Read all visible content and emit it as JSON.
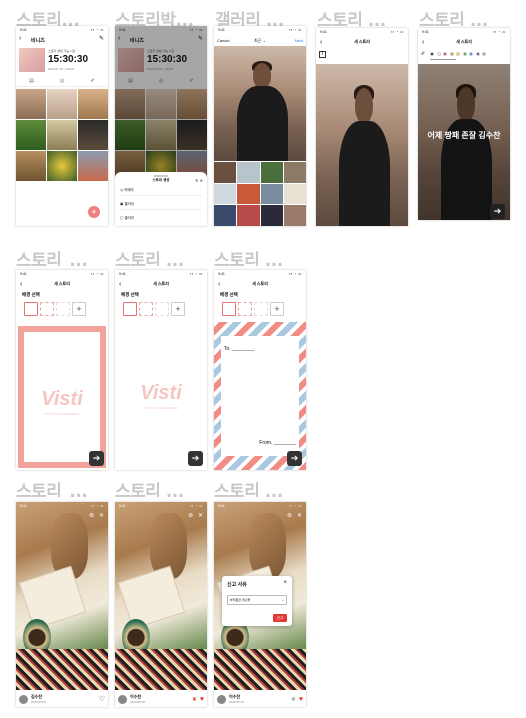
{
  "frame_labels": [
    "스토리...",
    "스토리박...",
    "갤러리 ...",
    "스토리 ...",
    "스토리 ...",
    "스토리_...",
    "스토리 ...",
    "스토리 ...",
    "스토리_...",
    "스토리 ...",
    "스토리 ..."
  ],
  "status_time": "9:41",
  "story_box": {
    "title": "비니즈",
    "sub": "스토리 생성 가능 시간",
    "countdown": "15:30:30",
    "range": "2023.07.15 ~ 08.05",
    "fab": "+"
  },
  "action_sheet": {
    "title": "스토리 생성",
    "items": [
      "카메라",
      "갤러리",
      "갤러리"
    ]
  },
  "gallery": {
    "cancel": "Cancel",
    "title": "최근",
    "next": "Next"
  },
  "story_header": "새 스토리",
  "text_story": {
    "caption": "어제 짱패 존잘 김수찬",
    "palette": [
      "#111111",
      "#ffffff",
      "#e53935",
      "#fb8c00",
      "#fdd835",
      "#43a047",
      "#1e88e5",
      "#8e24aa",
      "#9e9e9e"
    ]
  },
  "bg_select": {
    "title": "배경 선택",
    "brand": "Visti",
    "brand_sub": "VISTI YOUR MEMORIES"
  },
  "postcard": {
    "to": "To.",
    "from": "From."
  },
  "viewer": [
    {
      "name": "김수찬",
      "date": "2023.05.05"
    },
    {
      "name": "이수찬",
      "date": "2023.05.05"
    },
    {
      "name": "이수찬",
      "date": "2023.05.05"
    }
  ],
  "report": {
    "title": "신고 사유",
    "placeholder": "부적절한 게시물",
    "submit": "신고",
    "close": "×"
  }
}
